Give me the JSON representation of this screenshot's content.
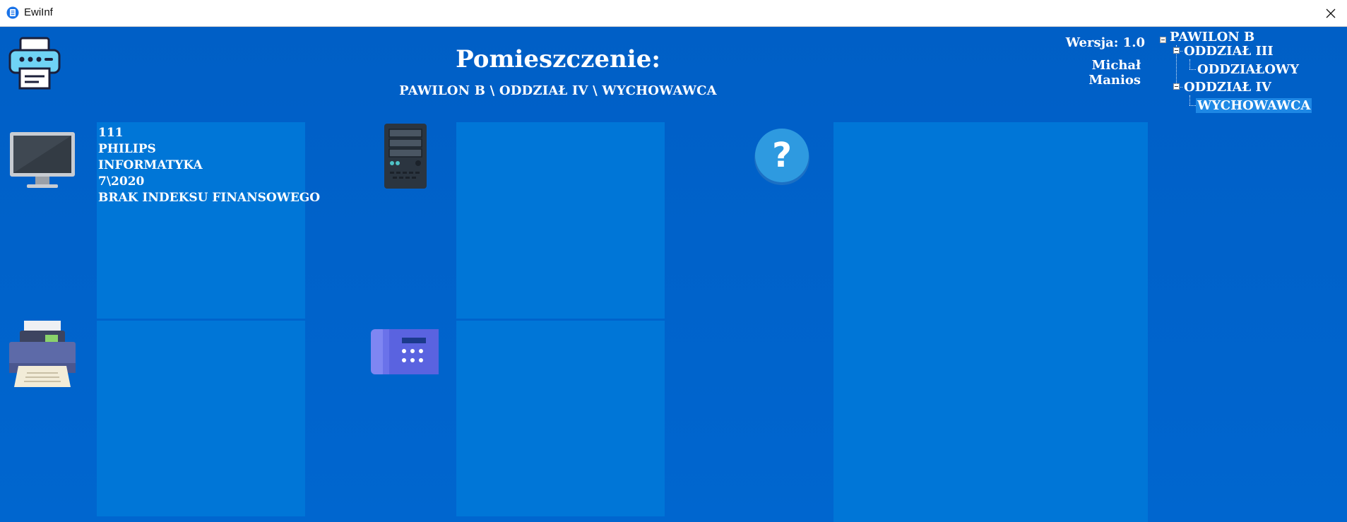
{
  "window": {
    "title": "EwiInf",
    "close_glyph": "✕"
  },
  "header": {
    "heading": "Pomieszczenie:",
    "path": "PAWILON B \\ ODDZIAŁ IV \\ WYCHOWAWCA",
    "version": "Wersja: 1.0",
    "author": "Michał Manios"
  },
  "tree": {
    "root": "PAWILON B",
    "dept1": "ODDZIAŁ III",
    "dept1_child": "ODDZIAŁOWY",
    "dept2": "ODDZIAŁ IV",
    "dept2_child": "WYCHOWAWCA"
  },
  "monitor_panel": {
    "lines": [
      "111",
      "PHILIPS",
      "INFORMATYKA",
      "7\\2020",
      "BRAK INDEKSU FINANSOWEGO"
    ]
  },
  "icons": {
    "print": "printer-icon",
    "monitor": "monitor-icon",
    "computer": "computer-tower-icon",
    "other": "question-mark-icon",
    "printer": "printer-device-icon",
    "phone": "phone-icon"
  },
  "colors": {
    "background": "#0063c9",
    "panel": "#0076d7",
    "selected": "#1e88e5"
  }
}
